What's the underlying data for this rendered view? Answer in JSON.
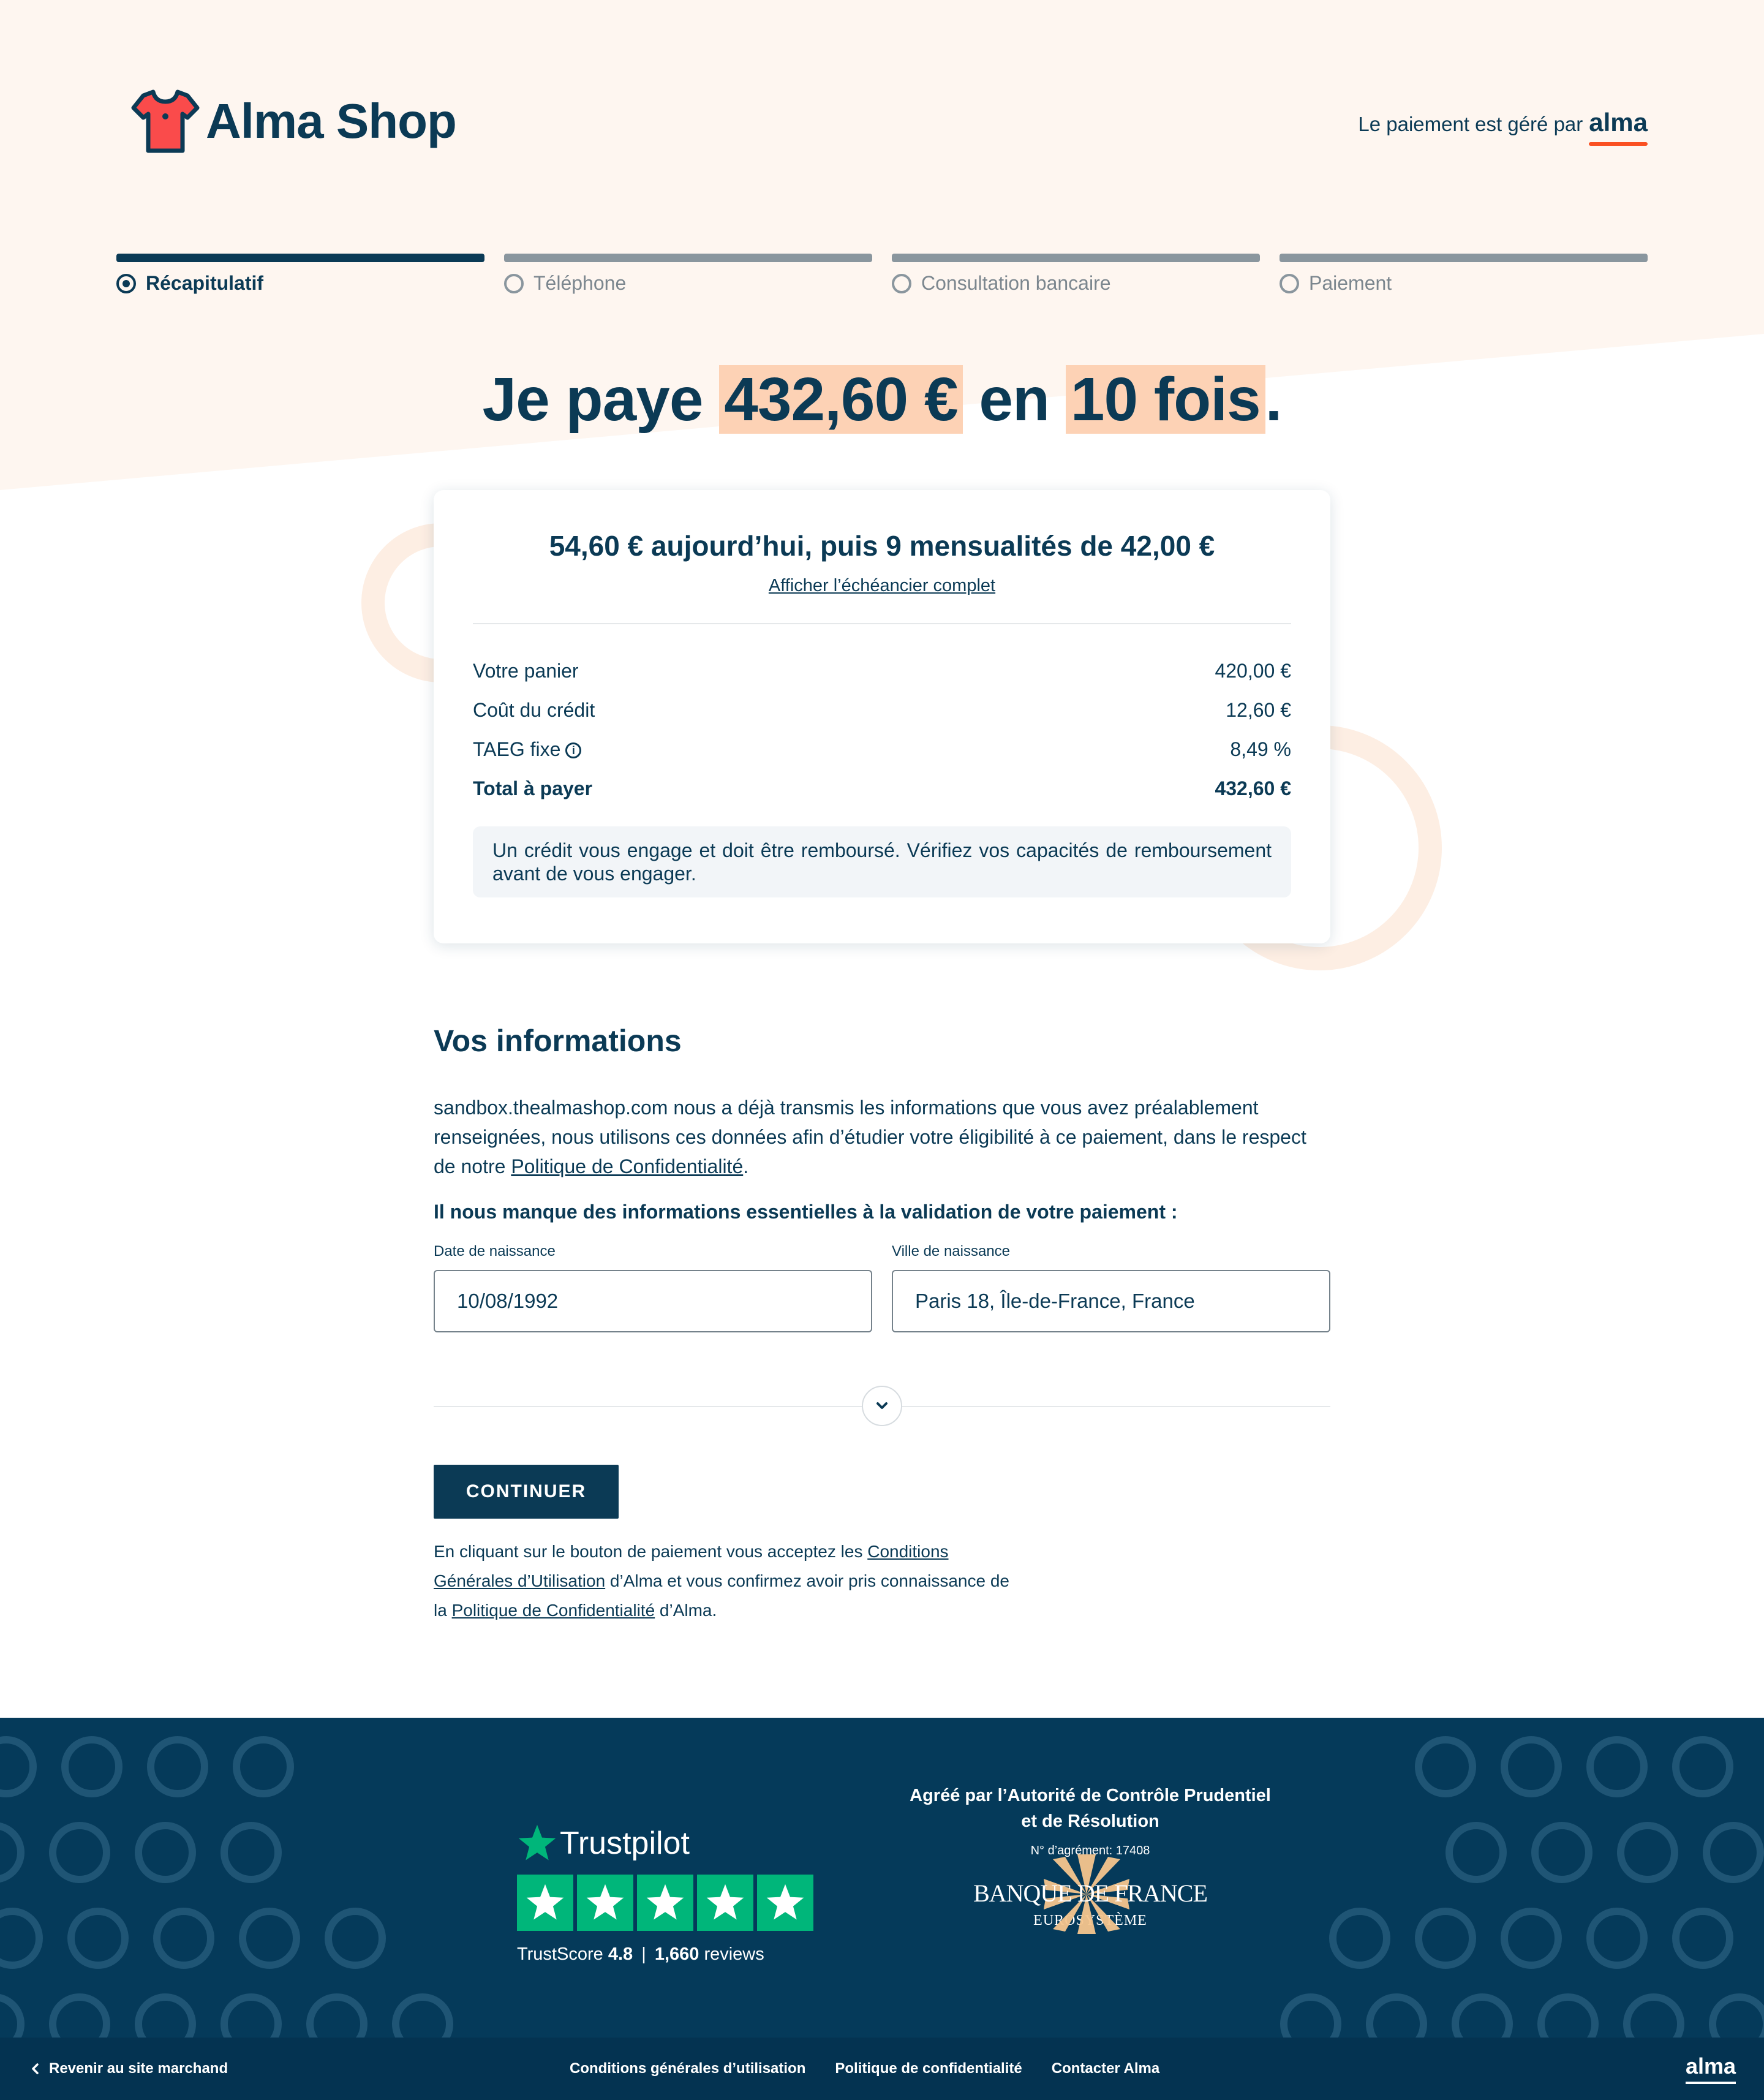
{
  "brand": {
    "name": "Alma Shop"
  },
  "managed": {
    "text": "Le paiement est géré par",
    "brand": "alma"
  },
  "steps": [
    {
      "label": "Récapitulatif",
      "active": true
    },
    {
      "label": "Téléphone",
      "active": false
    },
    {
      "label": "Consultation bancaire",
      "active": false
    },
    {
      "label": "Paiement",
      "active": false
    }
  ],
  "title": {
    "prefix": "Je paye",
    "amount": "432,60 €",
    "middle": "en",
    "installments": "10 fois",
    "suffix": "."
  },
  "summary": {
    "headline": "54,60 € aujourd’hui, puis 9 mensualités de 42,00 €",
    "schedule_link": "Afficher l’échéancier complet",
    "rows": [
      {
        "label": "Votre panier",
        "value": "420,00 €"
      },
      {
        "label": "Coût du crédit",
        "value": "12,60 €"
      },
      {
        "label": "TAEG fixe",
        "value": "8,49 %"
      },
      {
        "label": "Total à payer",
        "value": "432,60 €"
      }
    ],
    "warning": "Un crédit vous engage et doit être remboursé. Vérifiez vos capacités de remboursement avant de vous engager."
  },
  "info": {
    "heading": "Vos informations",
    "paragraph": "sandbox.thealmashop.com nous a déjà transmis les informations que vous avez préalablement renseignées, nous utilisons ces données afin d’étudier votre éligibilité à ce paiement, dans le respect de notre",
    "privacy_link": "Politique de Confidentialité",
    "paragraph_end": ".",
    "missing": "Il nous manque des informations essentielles à la validation de votre paiement :",
    "birth_date": {
      "label": "Date de naissance",
      "value": "10/08/1992"
    },
    "birth_city": {
      "label": "Ville de naissance",
      "value": "Paris 18, Île-de-France, France"
    },
    "continue_label": "CONTINUER",
    "legal_1": "En cliquant sur le bouton de paiement vous acceptez les",
    "legal_cgu": "Conditions Générales d’Utilisation",
    "legal_2": " d’Alma et vous confirmez avoir pris connaissance de la ",
    "legal_privacy": "Politique de Confidentialité",
    "legal_3": " d’Alma."
  },
  "footer": {
    "trustpilot": {
      "brand": "Trustpilot",
      "score_label": "TrustScore",
      "score": "4.8",
      "separator": "|",
      "reviews": "1,660",
      "reviews_label": "reviews"
    },
    "acpr": {
      "title": "Agréé par l’Autorité de Contrôle Prudentiel et de Résolution",
      "number": "N° d’agrément: 17408"
    },
    "bdf": {
      "name": "BANQUE DE FRANCE",
      "sub": "EUROSYSTÈME"
    },
    "back": "Revenir au site marchand",
    "links": [
      "Conditions générales d’utilisation",
      "Politique de confidentialité",
      "Contacter Alma"
    ],
    "logo": "alma"
  },
  "colors": {
    "navy": "#0b3a55",
    "peach": "#fdd2b5",
    "accent": "#fa5022",
    "trustpilot": "#00b67a",
    "footer": "#053a5a"
  },
  "icons": [
    "tshirt-logo-icon",
    "info-icon",
    "chevron-down-icon",
    "trustpilot-star-icon",
    "chevron-left-icon"
  ]
}
